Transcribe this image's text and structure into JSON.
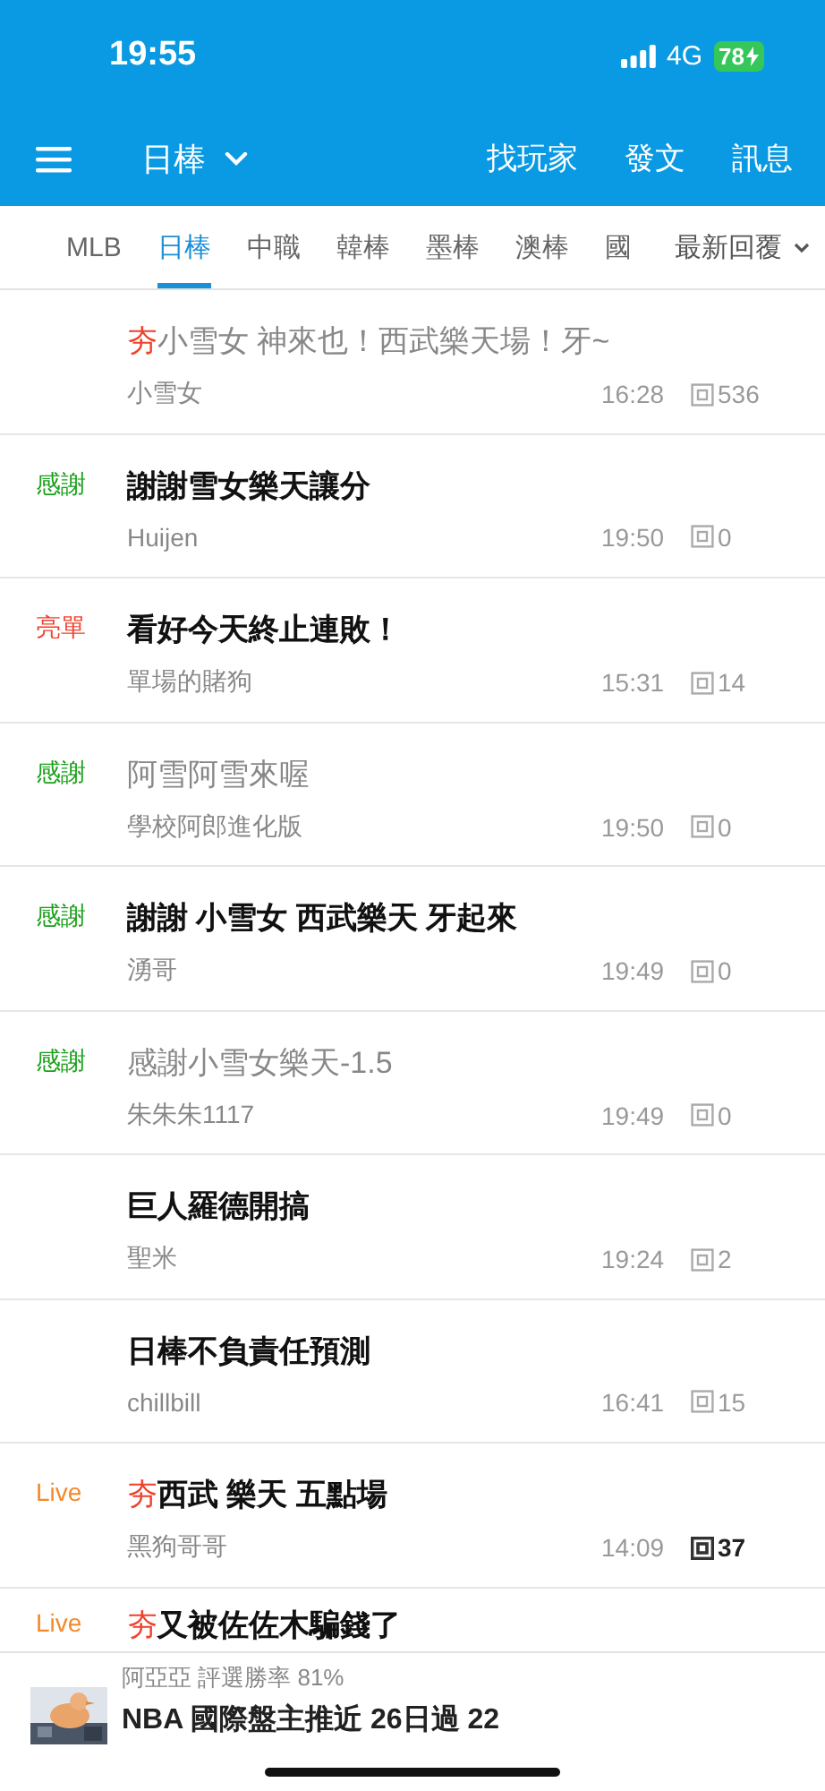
{
  "status_bar": {
    "time": "19:55",
    "network": "4G",
    "battery": "78"
  },
  "nav": {
    "board": "日棒",
    "actions": [
      {
        "label": "找玩家"
      },
      {
        "label": "發文"
      },
      {
        "label": "訊息"
      }
    ]
  },
  "tabs": [
    {
      "label": "MLB",
      "selected": false
    },
    {
      "label": "日棒",
      "selected": true
    },
    {
      "label": "中職",
      "selected": false
    },
    {
      "label": "韓棒",
      "selected": false
    },
    {
      "label": "墨棒",
      "selected": false
    },
    {
      "label": "澳棒",
      "selected": false
    },
    {
      "label": "國",
      "selected": false
    }
  ],
  "sort": {
    "label": "最新回覆"
  },
  "posts": [
    {
      "hot": "夯",
      "title": "小雪女 神來也！西武樂天場！牙~",
      "read": true,
      "author": "小雪女",
      "time": "16:28",
      "replies": "536",
      "replies_bold": false
    },
    {
      "tag": "感謝",
      "color": "#1aa01a",
      "title": "謝謝雪女樂天讓分",
      "read": false,
      "author": "Huijen",
      "time": "19:50",
      "replies": "0",
      "replies_bold": false
    },
    {
      "tag": "亮單",
      "color": "#f0422d",
      "title": "看好今天終止連敗！",
      "read": false,
      "author": "單場的賭狗",
      "time": "15:31",
      "replies": "14",
      "replies_bold": false
    },
    {
      "tag": "感謝",
      "color": "#1aa01a",
      "title": "阿雪阿雪來喔",
      "read": true,
      "author": "學校阿郎進化版",
      "time": "19:50",
      "replies": "0",
      "replies_bold": false
    },
    {
      "tag": "感謝",
      "color": "#1aa01a",
      "title": "謝謝 小雪女 西武樂天 牙起來",
      "read": false,
      "author": "湧哥",
      "time": "19:49",
      "replies": "0",
      "replies_bold": false
    },
    {
      "tag": "感謝",
      "color": "#1aa01a",
      "title": "感謝小雪女樂天-1.5",
      "read": true,
      "author": "朱朱朱1117",
      "time": "19:49",
      "replies": "0",
      "replies_bold": false
    },
    {
      "title": "巨人羅德開搞",
      "read": false,
      "author": "聖米",
      "time": "19:24",
      "replies": "2",
      "replies_bold": false
    },
    {
      "title": "日棒不負責任預測",
      "read": false,
      "author": "chillbill",
      "time": "16:41",
      "replies": "15",
      "replies_bold": false
    },
    {
      "tag": "Live",
      "color": "#f5892a",
      "hot": "夯",
      "title": "西武 樂天 五點場",
      "read": false,
      "author": "黑狗哥哥",
      "time": "14:09",
      "replies": "37",
      "replies_bold": true
    },
    {
      "tag": "Live",
      "color": "#f5892a",
      "hot": "夯",
      "title": "又被佐佐木騙錢了",
      "read": false,
      "partial": true
    }
  ],
  "promo": {
    "kind": "picture",
    "subtitle": "阿亞亞 評選勝率 81%",
    "title": "NBA 國際盤主推近 26日過 22"
  }
}
